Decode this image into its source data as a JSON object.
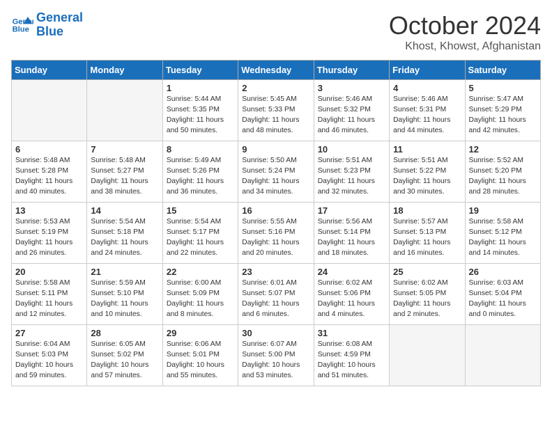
{
  "logo": {
    "line1": "General",
    "line2": "Blue"
  },
  "title": "October 2024",
  "location": "Khost, Khowst, Afghanistan",
  "headers": [
    "Sunday",
    "Monday",
    "Tuesday",
    "Wednesday",
    "Thursday",
    "Friday",
    "Saturday"
  ],
  "weeks": [
    [
      {
        "day": "",
        "info": ""
      },
      {
        "day": "",
        "info": ""
      },
      {
        "day": "1",
        "info": "Sunrise: 5:44 AM\nSunset: 5:35 PM\nDaylight: 11 hours and 50 minutes."
      },
      {
        "day": "2",
        "info": "Sunrise: 5:45 AM\nSunset: 5:33 PM\nDaylight: 11 hours and 48 minutes."
      },
      {
        "day": "3",
        "info": "Sunrise: 5:46 AM\nSunset: 5:32 PM\nDaylight: 11 hours and 46 minutes."
      },
      {
        "day": "4",
        "info": "Sunrise: 5:46 AM\nSunset: 5:31 PM\nDaylight: 11 hours and 44 minutes."
      },
      {
        "day": "5",
        "info": "Sunrise: 5:47 AM\nSunset: 5:29 PM\nDaylight: 11 hours and 42 minutes."
      }
    ],
    [
      {
        "day": "6",
        "info": "Sunrise: 5:48 AM\nSunset: 5:28 PM\nDaylight: 11 hours and 40 minutes."
      },
      {
        "day": "7",
        "info": "Sunrise: 5:48 AM\nSunset: 5:27 PM\nDaylight: 11 hours and 38 minutes."
      },
      {
        "day": "8",
        "info": "Sunrise: 5:49 AM\nSunset: 5:26 PM\nDaylight: 11 hours and 36 minutes."
      },
      {
        "day": "9",
        "info": "Sunrise: 5:50 AM\nSunset: 5:24 PM\nDaylight: 11 hours and 34 minutes."
      },
      {
        "day": "10",
        "info": "Sunrise: 5:51 AM\nSunset: 5:23 PM\nDaylight: 11 hours and 32 minutes."
      },
      {
        "day": "11",
        "info": "Sunrise: 5:51 AM\nSunset: 5:22 PM\nDaylight: 11 hours and 30 minutes."
      },
      {
        "day": "12",
        "info": "Sunrise: 5:52 AM\nSunset: 5:20 PM\nDaylight: 11 hours and 28 minutes."
      }
    ],
    [
      {
        "day": "13",
        "info": "Sunrise: 5:53 AM\nSunset: 5:19 PM\nDaylight: 11 hours and 26 minutes."
      },
      {
        "day": "14",
        "info": "Sunrise: 5:54 AM\nSunset: 5:18 PM\nDaylight: 11 hours and 24 minutes."
      },
      {
        "day": "15",
        "info": "Sunrise: 5:54 AM\nSunset: 5:17 PM\nDaylight: 11 hours and 22 minutes."
      },
      {
        "day": "16",
        "info": "Sunrise: 5:55 AM\nSunset: 5:16 PM\nDaylight: 11 hours and 20 minutes."
      },
      {
        "day": "17",
        "info": "Sunrise: 5:56 AM\nSunset: 5:14 PM\nDaylight: 11 hours and 18 minutes."
      },
      {
        "day": "18",
        "info": "Sunrise: 5:57 AM\nSunset: 5:13 PM\nDaylight: 11 hours and 16 minutes."
      },
      {
        "day": "19",
        "info": "Sunrise: 5:58 AM\nSunset: 5:12 PM\nDaylight: 11 hours and 14 minutes."
      }
    ],
    [
      {
        "day": "20",
        "info": "Sunrise: 5:58 AM\nSunset: 5:11 PM\nDaylight: 11 hours and 12 minutes."
      },
      {
        "day": "21",
        "info": "Sunrise: 5:59 AM\nSunset: 5:10 PM\nDaylight: 11 hours and 10 minutes."
      },
      {
        "day": "22",
        "info": "Sunrise: 6:00 AM\nSunset: 5:09 PM\nDaylight: 11 hours and 8 minutes."
      },
      {
        "day": "23",
        "info": "Sunrise: 6:01 AM\nSunset: 5:07 PM\nDaylight: 11 hours and 6 minutes."
      },
      {
        "day": "24",
        "info": "Sunrise: 6:02 AM\nSunset: 5:06 PM\nDaylight: 11 hours and 4 minutes."
      },
      {
        "day": "25",
        "info": "Sunrise: 6:02 AM\nSunset: 5:05 PM\nDaylight: 11 hours and 2 minutes."
      },
      {
        "day": "26",
        "info": "Sunrise: 6:03 AM\nSunset: 5:04 PM\nDaylight: 11 hours and 0 minutes."
      }
    ],
    [
      {
        "day": "27",
        "info": "Sunrise: 6:04 AM\nSunset: 5:03 PM\nDaylight: 10 hours and 59 minutes."
      },
      {
        "day": "28",
        "info": "Sunrise: 6:05 AM\nSunset: 5:02 PM\nDaylight: 10 hours and 57 minutes."
      },
      {
        "day": "29",
        "info": "Sunrise: 6:06 AM\nSunset: 5:01 PM\nDaylight: 10 hours and 55 minutes."
      },
      {
        "day": "30",
        "info": "Sunrise: 6:07 AM\nSunset: 5:00 PM\nDaylight: 10 hours and 53 minutes."
      },
      {
        "day": "31",
        "info": "Sunrise: 6:08 AM\nSunset: 4:59 PM\nDaylight: 10 hours and 51 minutes."
      },
      {
        "day": "",
        "info": ""
      },
      {
        "day": "",
        "info": ""
      }
    ]
  ]
}
